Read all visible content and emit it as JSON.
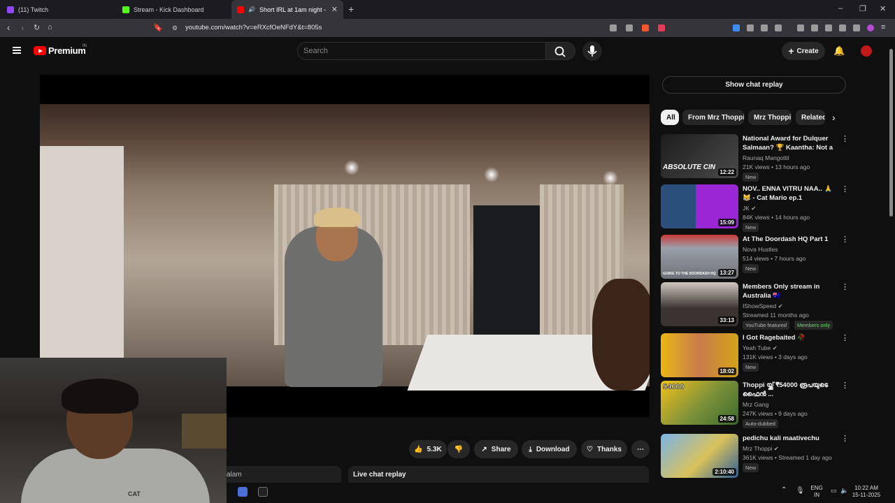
{
  "browser": {
    "tabs": [
      {
        "label": "(11) Twitch",
        "favicon_color": "#9146ff"
      },
      {
        "label": "Stream - Kick Dashboard",
        "favicon_color": "#53fc18"
      },
      {
        "label": "Short IRL at 1am night - YouT",
        "favicon_color": "#ff0000",
        "active": true
      }
    ],
    "url": "youtube.com/watch?v=eRXcfOeNFdY&t=805s"
  },
  "youtube": {
    "logo_text": "Premium",
    "region": "IN",
    "search_placeholder": "Search",
    "create_label": "Create"
  },
  "actions": {
    "likes": "5.3K",
    "share": "Share",
    "download": "Download",
    "thanks": "Thanks"
  },
  "tabs_below": {
    "left": "alam",
    "right": "Live chat replay"
  },
  "webcam_text": "CAT",
  "sidebar": {
    "chat_replay_button": "Show chat replay",
    "chips": [
      "All",
      "From Mrz Thoppi",
      "Mrz Thoppi",
      "Related"
    ],
    "recommendations": [
      {
        "title": "National Award for Dulquer Salmaan? 🏆 Kaantha: Not a ...",
        "channel": "Raunaq Mangottil",
        "meta": "21K views • 13 hours ago",
        "badge": "New",
        "duration": "12:22",
        "thumb_text": "ABSOLUTE CIN",
        "thumb_color": "#2b2b2b"
      },
      {
        "title": "NOV.. ENNA VITRU NAA.. 🙏😹 - Cat Mario ep.1",
        "channel": "JK ✔",
        "meta": "84K views • 14 hours ago",
        "badge": "New",
        "duration": "15:09",
        "thumb_text": "",
        "thumb_color": "#7a1ec9"
      },
      {
        "title": "At The Doordash HQ Part 1",
        "channel": "Nova Hustles",
        "meta": "514 views • 7 hours ago",
        "badge": "New",
        "duration": "13:27",
        "thumb_text": "GOING TO THE DOORDASH HQ",
        "thumb_color": "#8a8f96"
      },
      {
        "title": "Members Only stream in Australia 🇦🇺",
        "channel": "IShowSpeed ✔",
        "meta": "Streamed 11 months ago",
        "badge": "YouTube featured",
        "badge2": "Members only",
        "duration": "33:13",
        "thumb_text": "",
        "thumb_color": "#3a3330"
      },
      {
        "title": "I Got Ragebaited 🥀",
        "channel": "Yeah Tube ✔",
        "meta": "131K views • 3 days ago",
        "badge": "New",
        "duration": "18:02",
        "thumb_text": "",
        "thumb_color": "#d4a316"
      },
      {
        "title": "Thoppi യ്ക്ക് ₹54000 രൂപയുടെ ഫൈൻ ...",
        "channel": "Mrz Gang",
        "meta": "247K views • 9 days ago",
        "badge": "Auto-dubbed",
        "duration": "24:58",
        "thumb_text": "54000",
        "thumb_color": "#e0b11b"
      },
      {
        "title": "pedichu kali maativechu",
        "channel": "Mrz Thoppi ✔",
        "meta": "361K views • Streamed 1 day ago",
        "badge": "New",
        "duration": "2:10:40",
        "thumb_text": "",
        "thumb_color": "#5d9bd6"
      }
    ]
  },
  "taskbar": {
    "lang": "ENG",
    "lang2": "IN",
    "time": "10:22 AM",
    "date": "15-11-2025"
  }
}
